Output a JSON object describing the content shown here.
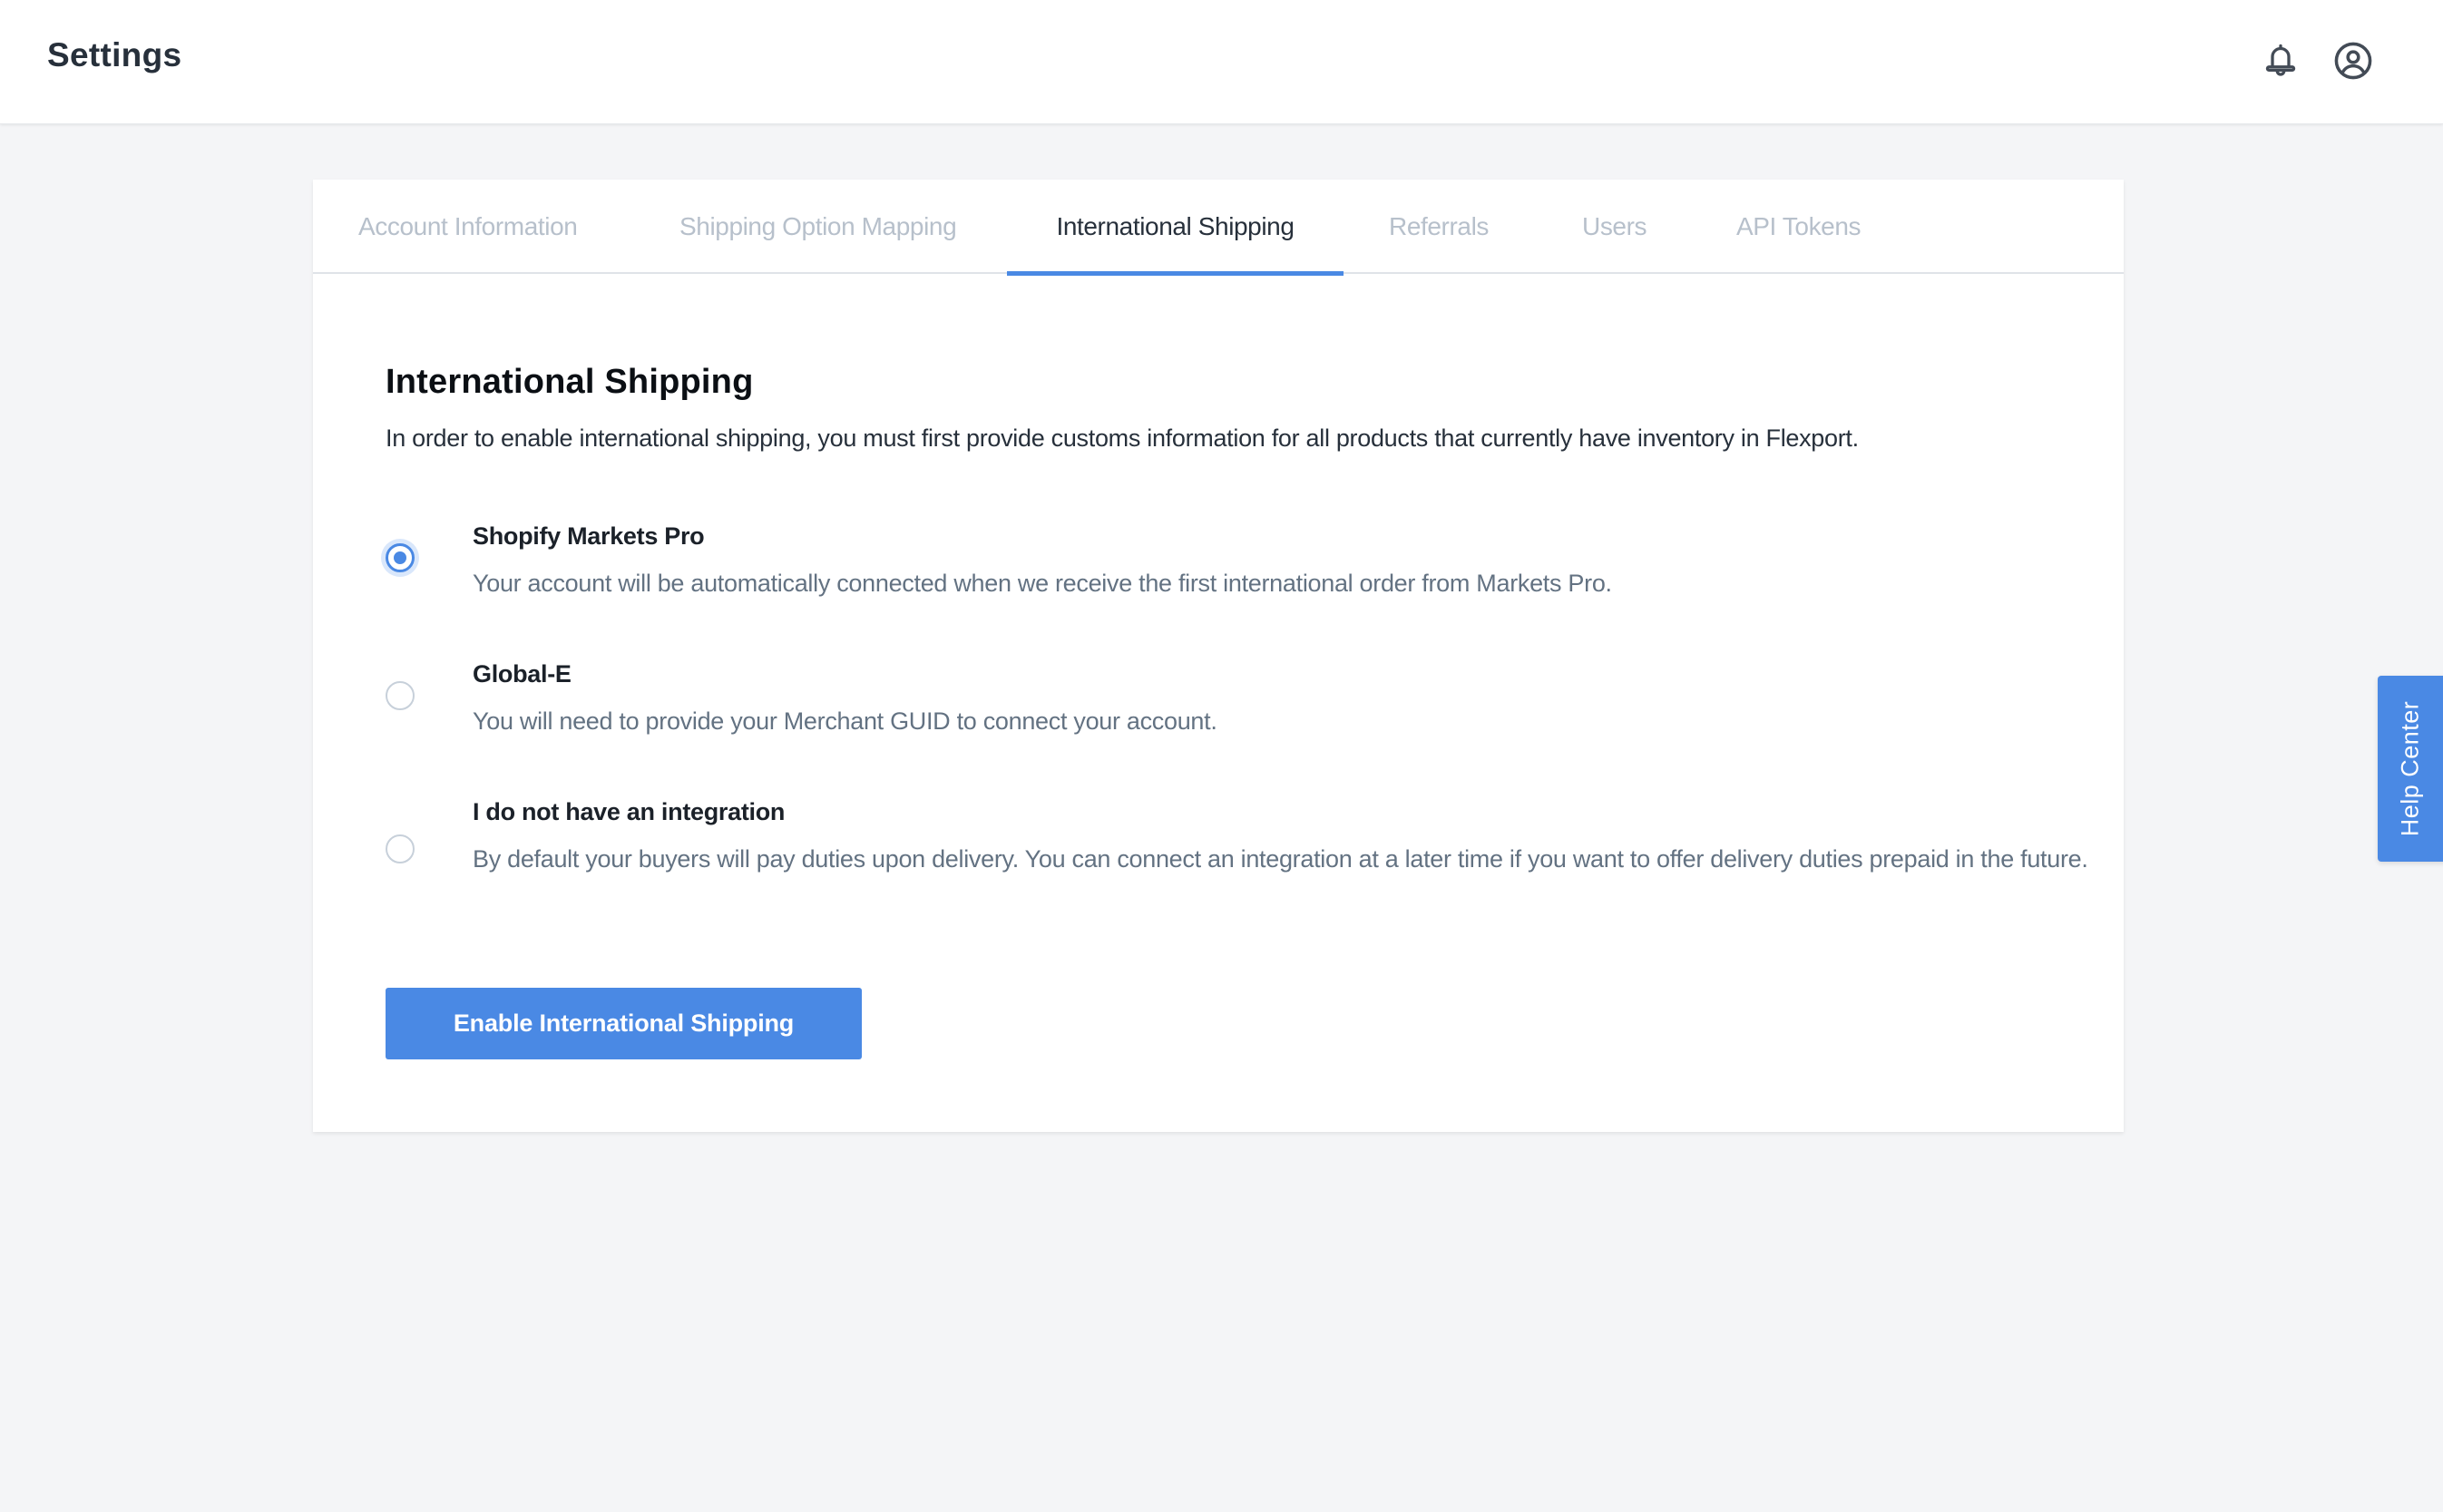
{
  "header": {
    "title": "Settings",
    "icons": [
      "bell-icon",
      "user-circle-icon"
    ]
  },
  "tabs": [
    {
      "label": "Account Information",
      "active": false
    },
    {
      "label": "Shipping Option Mapping",
      "active": false
    },
    {
      "label": "International Shipping",
      "active": true
    },
    {
      "label": "Referrals",
      "active": false
    },
    {
      "label": "Users",
      "active": false
    },
    {
      "label": "API Tokens",
      "active": false
    }
  ],
  "section": {
    "title": "International Shipping",
    "description": "In order to enable international shipping, you must first provide customs information for all products that currently have inventory in Flexport."
  },
  "options": [
    {
      "title": "Shopify Markets Pro",
      "description": "Your account will be automatically connected when we receive the first international order from Markets Pro.",
      "selected": true
    },
    {
      "title": "Global-E",
      "description": "You will need to provide your Merchant GUID to connect your account.",
      "selected": false
    },
    {
      "title": "I do not have an integration",
      "description": "By default your buyers will pay duties upon delivery. You can connect an integration at a later time if you want to offer delivery duties prepaid in the future.",
      "selected": false
    }
  ],
  "actions": {
    "enable_label": "Enable International Shipping"
  },
  "help": {
    "label": "Help Center"
  },
  "colors": {
    "accent": "#4a89e4",
    "background": "#f4f5f7",
    "text_primary": "#27303b",
    "text_muted": "#637282",
    "tab_inactive": "#b7c0cb"
  }
}
